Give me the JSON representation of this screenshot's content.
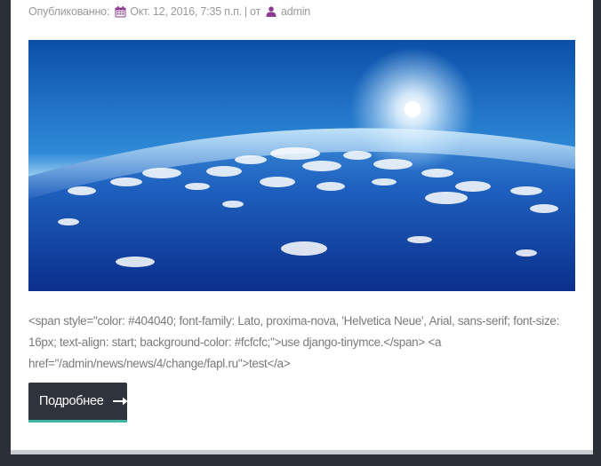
{
  "meta": {
    "published_label": "Опубликованно:",
    "date": "Окт. 12, 2016, 7:35 п.п.",
    "separator": "|",
    "by_label": "от",
    "author": "admin",
    "calendar_icon": "calendar-icon",
    "user_icon": "user-icon",
    "accent_color": "#8e3a8e"
  },
  "post": {
    "body": "<span style=\"color: #404040; font-family: Lato, proxima-nova, 'Helvetica Neue', Arial, sans-serif; font-size: 16px; text-align: start; background-color: #fcfcfc;\">use django-tinymce.</span> <a href=\"/admin/news/news/4/change/fapl.ru\">test</a>"
  },
  "button": {
    "label": "Подробнее",
    "icon": "arrow-right-icon",
    "background": "#2f333b",
    "underline_color": "#3cb6a0"
  }
}
